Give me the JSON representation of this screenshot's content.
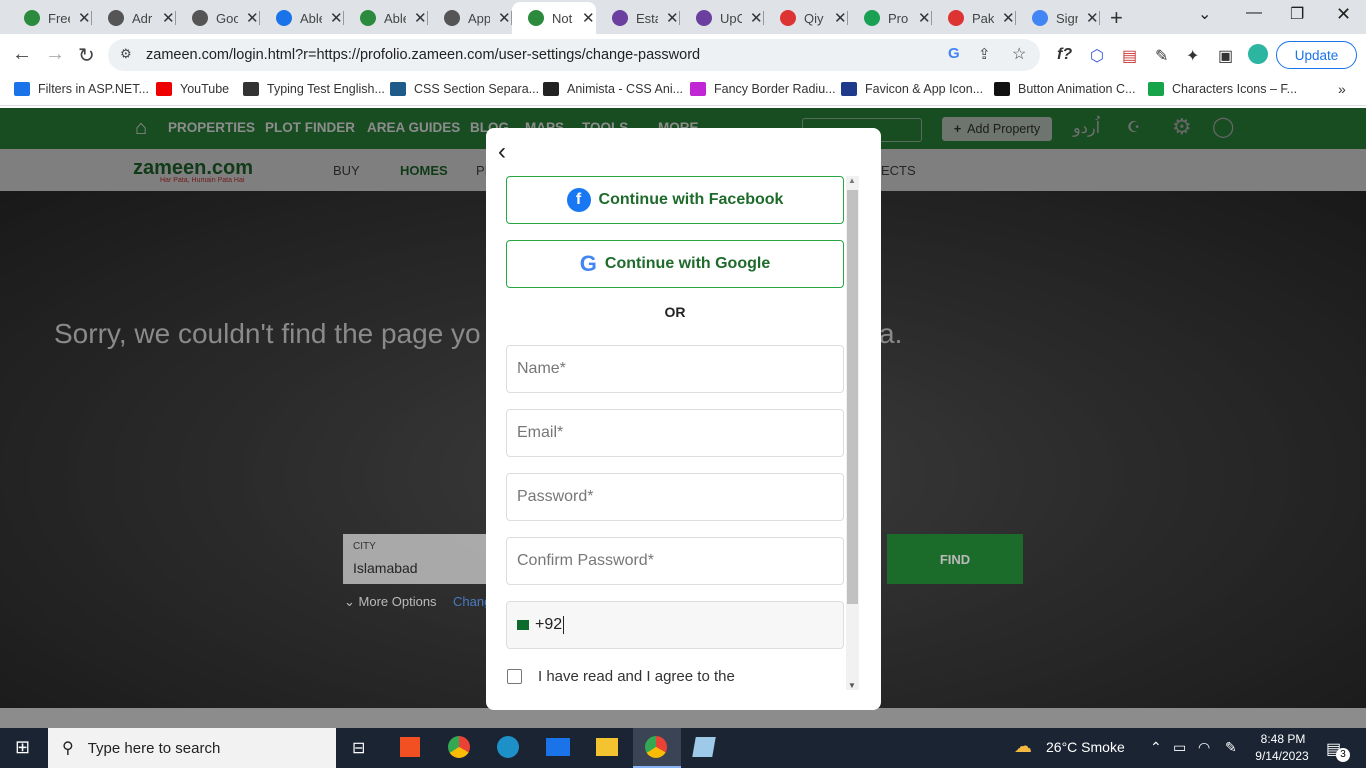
{
  "tabs": [
    {
      "title": "Free",
      "color": "#2c8a3c"
    },
    {
      "title": "Adr",
      "color": "#555"
    },
    {
      "title": "Goo",
      "color": "#555"
    },
    {
      "title": "Able",
      "color": "#1a73e8"
    },
    {
      "title": "Able",
      "color": "#2c8a3c"
    },
    {
      "title": "App",
      "color": "#555"
    },
    {
      "title": "Not",
      "color": "#2c8a3c",
      "active": true
    },
    {
      "title": "Esta",
      "color": "#6a3fa0"
    },
    {
      "title": "UpC",
      "color": "#6a3fa0"
    },
    {
      "title": "Qiy",
      "color": "#d33"
    },
    {
      "title": "Pro",
      "color": "#1aa053"
    },
    {
      "title": "Pak",
      "color": "#d33"
    },
    {
      "title": "Sign",
      "color": "#4285f4"
    }
  ],
  "address": {
    "url": "zameen.com/login.html?r=https://profolio.zameen.com/user-settings/change-password",
    "update_label": "Update"
  },
  "bookmarks": [
    {
      "label": "Filters in ASP.NET...",
      "color": "#1a73e8"
    },
    {
      "label": "YouTube",
      "color": "#e00"
    },
    {
      "label": "Typing Test English...",
      "color": "#333"
    },
    {
      "label": "CSS Section Separa...",
      "color": "#1e5a8a"
    },
    {
      "label": "Animista - CSS Ani...",
      "color": "#222"
    },
    {
      "label": "Fancy Border Radiu...",
      "color": "#c026d3"
    },
    {
      "label": "Favicon & App Icon...",
      "color": "#1e3a8a"
    },
    {
      "label": "Button Animation C...",
      "color": "#111"
    },
    {
      "label": "Characters Icons – F...",
      "color": "#16a34a"
    }
  ],
  "site": {
    "nav": [
      "PROPERTIES",
      "PLOT FINDER",
      "AREA GUIDES",
      "BLOG",
      "MAPS",
      "TOOLS",
      "MORE"
    ],
    "add_property": "Add Property",
    "urdu": "اُردو",
    "logo": "zameen.com",
    "tagline": "Har Pata, Humain Pata Hai",
    "subnav": [
      "BUY",
      "HOMES",
      "PI",
      "ECTS"
    ],
    "sorry_text": "Sorry, we couldn't find the page yo                                    st specify the new search criteria.",
    "city_label": "CITY",
    "city_value": "Islamabad",
    "more_options": "More Options",
    "change": "Chang",
    "find": "FIND"
  },
  "modal": {
    "facebook": "Continue with Facebook",
    "google": "Continue with Google",
    "or": "OR",
    "name_placeholder": "Name*",
    "email_placeholder": "Email*",
    "password_placeholder": "Password*",
    "confirm_placeholder": "Confirm Password*",
    "phone_value": "+92",
    "agree_text": "I have read and I agree to the"
  },
  "taskbar": {
    "search_placeholder": "Type here to search",
    "weather": "26°C  Smoke",
    "time": "8:48 PM",
    "date": "9/14/2023",
    "notifications": "3"
  }
}
